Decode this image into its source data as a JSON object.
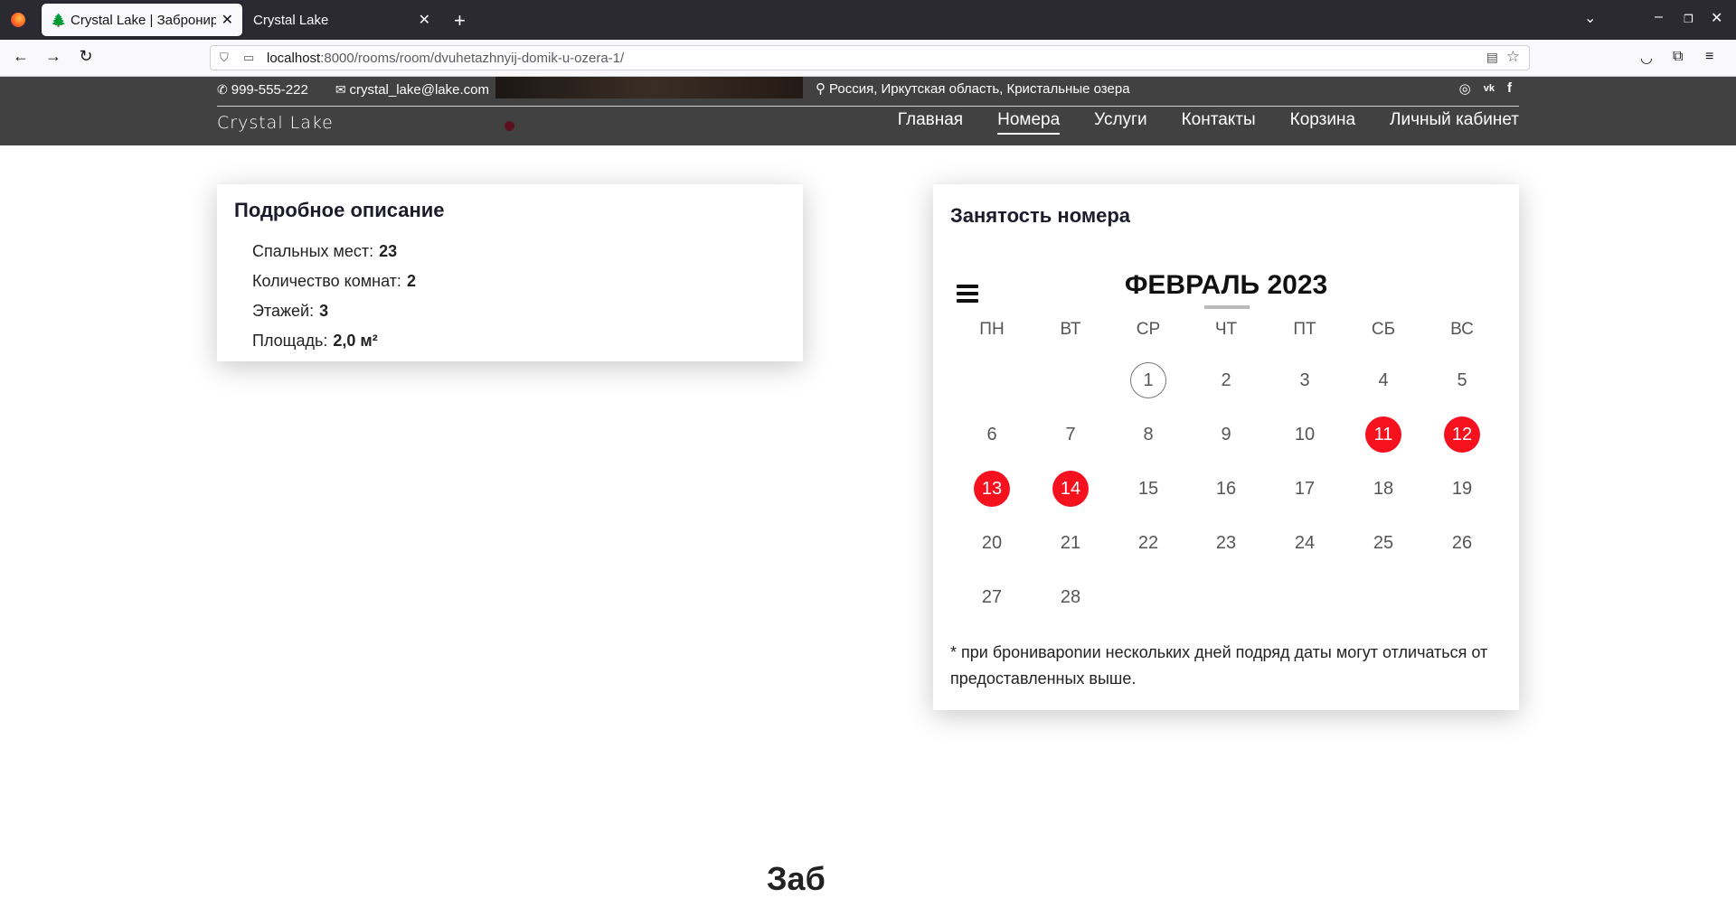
{
  "browser": {
    "tabs": [
      {
        "title": "Crystal Lake | Забронировать",
        "active": true
      },
      {
        "title": "Crystal Lake",
        "active": false
      }
    ],
    "url_host": "localhost",
    "url_path": ":8000/rooms/room/dvuhetazhnyij-domik-u-ozera-1/"
  },
  "header": {
    "phone": "999-555-222",
    "email": "crystal_lake@lake.com",
    "address": "Россия, Иркутская область, Кристальные озера",
    "brand": "Crystal Lake",
    "menu": [
      "Главная",
      "Номера",
      "Услуги",
      "Контакты",
      "Корзина",
      "Личный кабинет"
    ],
    "current_menu": "Номера"
  },
  "description": {
    "title": "Подробное описание",
    "rows": [
      {
        "label": "Спальных мест:",
        "value": "23"
      },
      {
        "label": "Количество комнат:",
        "value": "2"
      },
      {
        "label": "Этажей:",
        "value": "3"
      },
      {
        "label": "Площадь:",
        "value": "2,0 м²"
      }
    ]
  },
  "calendar": {
    "title": "Занятость номера",
    "month": "ФЕВРАЛЬ 2023",
    "weekdays": [
      "ПН",
      "ВТ",
      "СР",
      "ЧТ",
      "ПТ",
      "СБ",
      "ВС"
    ],
    "first_weekday_index": 2,
    "days_in_month": 28,
    "today": 1,
    "busy_days": [
      11,
      12,
      13,
      14
    ],
    "busy_color": "#f5111d",
    "note": "* при брониварonии нескольких дней подряд даты могут отличаться от предоставленных выше."
  },
  "bottom_text": "Заб"
}
